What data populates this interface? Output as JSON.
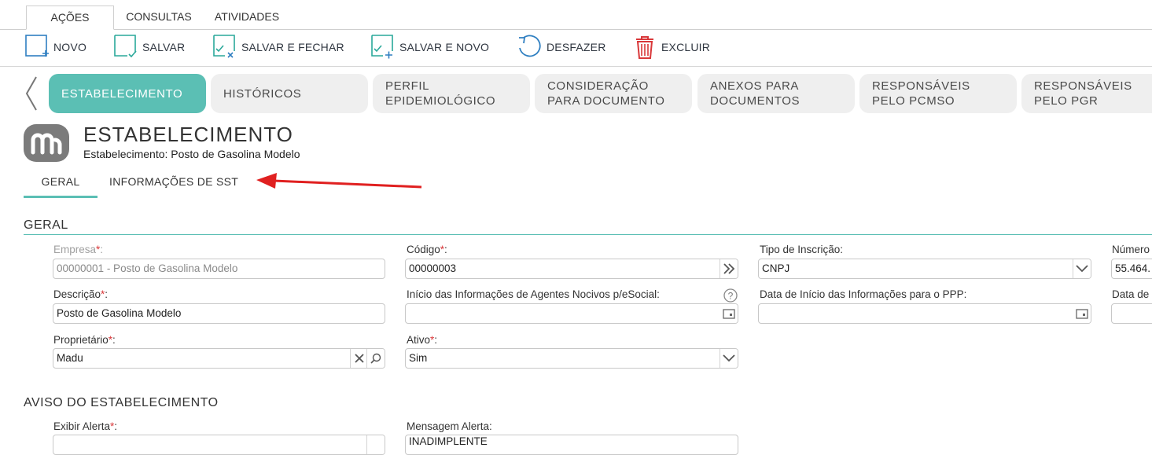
{
  "menu_tabs": [
    "AÇÕES",
    "CONSULTAS",
    "ATIVIDADES"
  ],
  "toolbar": {
    "novo": "NOVO",
    "salvar": "SALVAR",
    "salvar_fechar": "SALVAR E FECHAR",
    "salvar_novo": "SALVAR E NOVO",
    "desfazer": "DESFAZER",
    "excluir": "EXCLUIR"
  },
  "steps": [
    "ESTABELECIMENTO",
    "HISTÓRICOS",
    "PERFIL EPIDEMIOLÓGICO",
    "CONSIDERAÇÃO PARA DOCUMENTO",
    "ANEXOS PARA DOCUMENTOS",
    "RESPONSÁVEIS PELO PCMSO",
    "RESPONSÁVEIS PELO PGR"
  ],
  "header": {
    "title": "ESTABELECIMENTO",
    "subtitle": "Estabelecimento: Posto de Gasolina Modelo"
  },
  "sub_tabs": [
    "GERAL",
    "INFORMAÇÕES DE SST"
  ],
  "section_geral": "GERAL",
  "fields": {
    "empresa": {
      "label": "Empresa",
      "value": "00000001 - Posto de Gasolina Modelo"
    },
    "codigo": {
      "label": "Código",
      "value": "00000003"
    },
    "tipo_inscricao": {
      "label": "Tipo de Inscrição:",
      "value": "CNPJ"
    },
    "numero": {
      "label": "Número",
      "value": "55.464."
    },
    "descricao": {
      "label": "Descrição",
      "value": "Posto de Gasolina Modelo"
    },
    "inicio_agentes": {
      "label": "Início das Informações de Agentes Nocivos p/eSocial:",
      "value": ""
    },
    "data_inicio_ppp": {
      "label": "Data de Início das Informações para o PPP:",
      "value": ""
    },
    "data_de": {
      "label": "Data de",
      "value": ""
    },
    "proprietario": {
      "label": "Proprietário",
      "value": "Madu"
    },
    "ativo": {
      "label": "Ativo",
      "value": "Sim"
    },
    "exibir_alerta": {
      "label": "Exibir Alerta",
      "value": ""
    },
    "mensagem_alerta": {
      "label": "Mensagem Alerta:",
      "value": "INADIMPLENTE"
    }
  },
  "section_aviso": "AVISO DO ESTABELECIMENTO",
  "colors": {
    "accent": "#5bbfb4",
    "required": "#d9383a",
    "annotation_arrow": "#e02020"
  }
}
